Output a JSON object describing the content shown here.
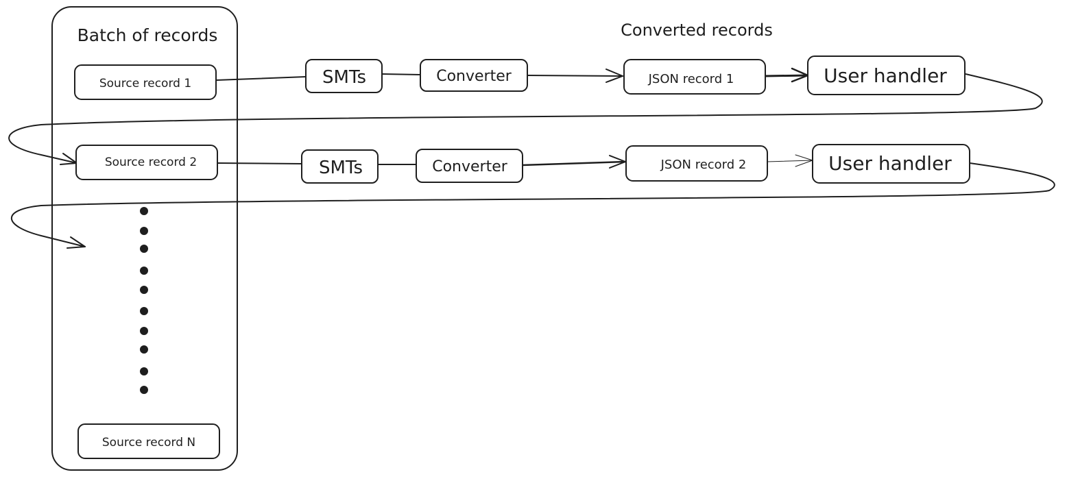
{
  "diagram": {
    "title_left": "Batch of records",
    "title_right": "Converted records",
    "colors": {
      "stroke": "#1e1e1e",
      "background": "#ffffff"
    },
    "batch": {
      "records": [
        {
          "id": "source1",
          "label": "Source record 1"
        },
        {
          "id": "source2",
          "label": "Source record 2"
        },
        {
          "id": "sourceN",
          "label": "Source record N"
        }
      ],
      "ellipsis_dot_count": 10
    },
    "rows": [
      {
        "source": "Source record 1",
        "smts": "SMTs",
        "converter": "Converter",
        "json": "JSON record 1",
        "handler": "User handler"
      },
      {
        "source": "Source record 2",
        "smts": "SMTs",
        "converter": "Converter",
        "json": "JSON record 2",
        "handler": "User handler"
      }
    ]
  }
}
